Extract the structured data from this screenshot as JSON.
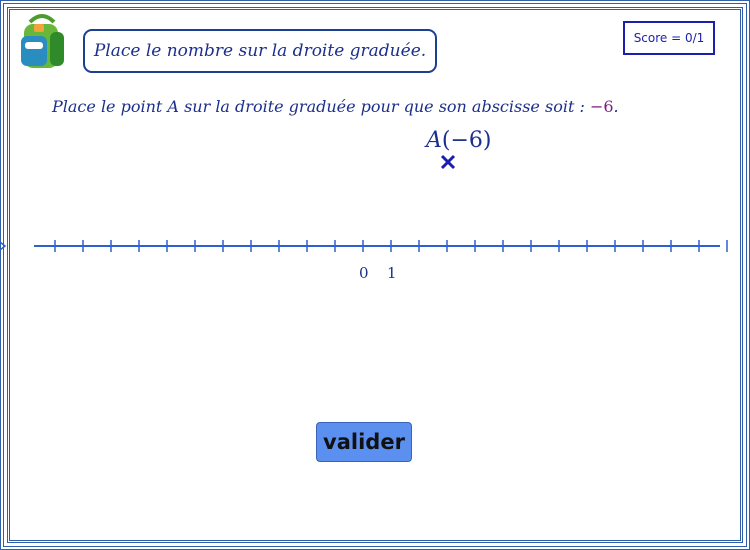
{
  "header": {
    "logo_icon": "backpack-icon",
    "title": "Place le nombre sur la droite graduée.",
    "score": "Score = 0/1"
  },
  "exercise": {
    "instruction_prefix": "Place le point A sur la droite graduée pour que son abscisse soit :",
    "target_value": "−6",
    "instruction_suffix": ".",
    "point_name": "A",
    "point_label_value": "(−6)",
    "marker_icon": "cross-marker-icon"
  },
  "number_line": {
    "tick_labels": [
      "0",
      "1"
    ],
    "color": "#2f5fd0"
  },
  "actions": {
    "validate_label": "valider"
  },
  "colors": {
    "frame": "#2f5fa7",
    "text": "#1c2f8c",
    "value": "#7b1c7f",
    "button": "#5b8ff0"
  }
}
